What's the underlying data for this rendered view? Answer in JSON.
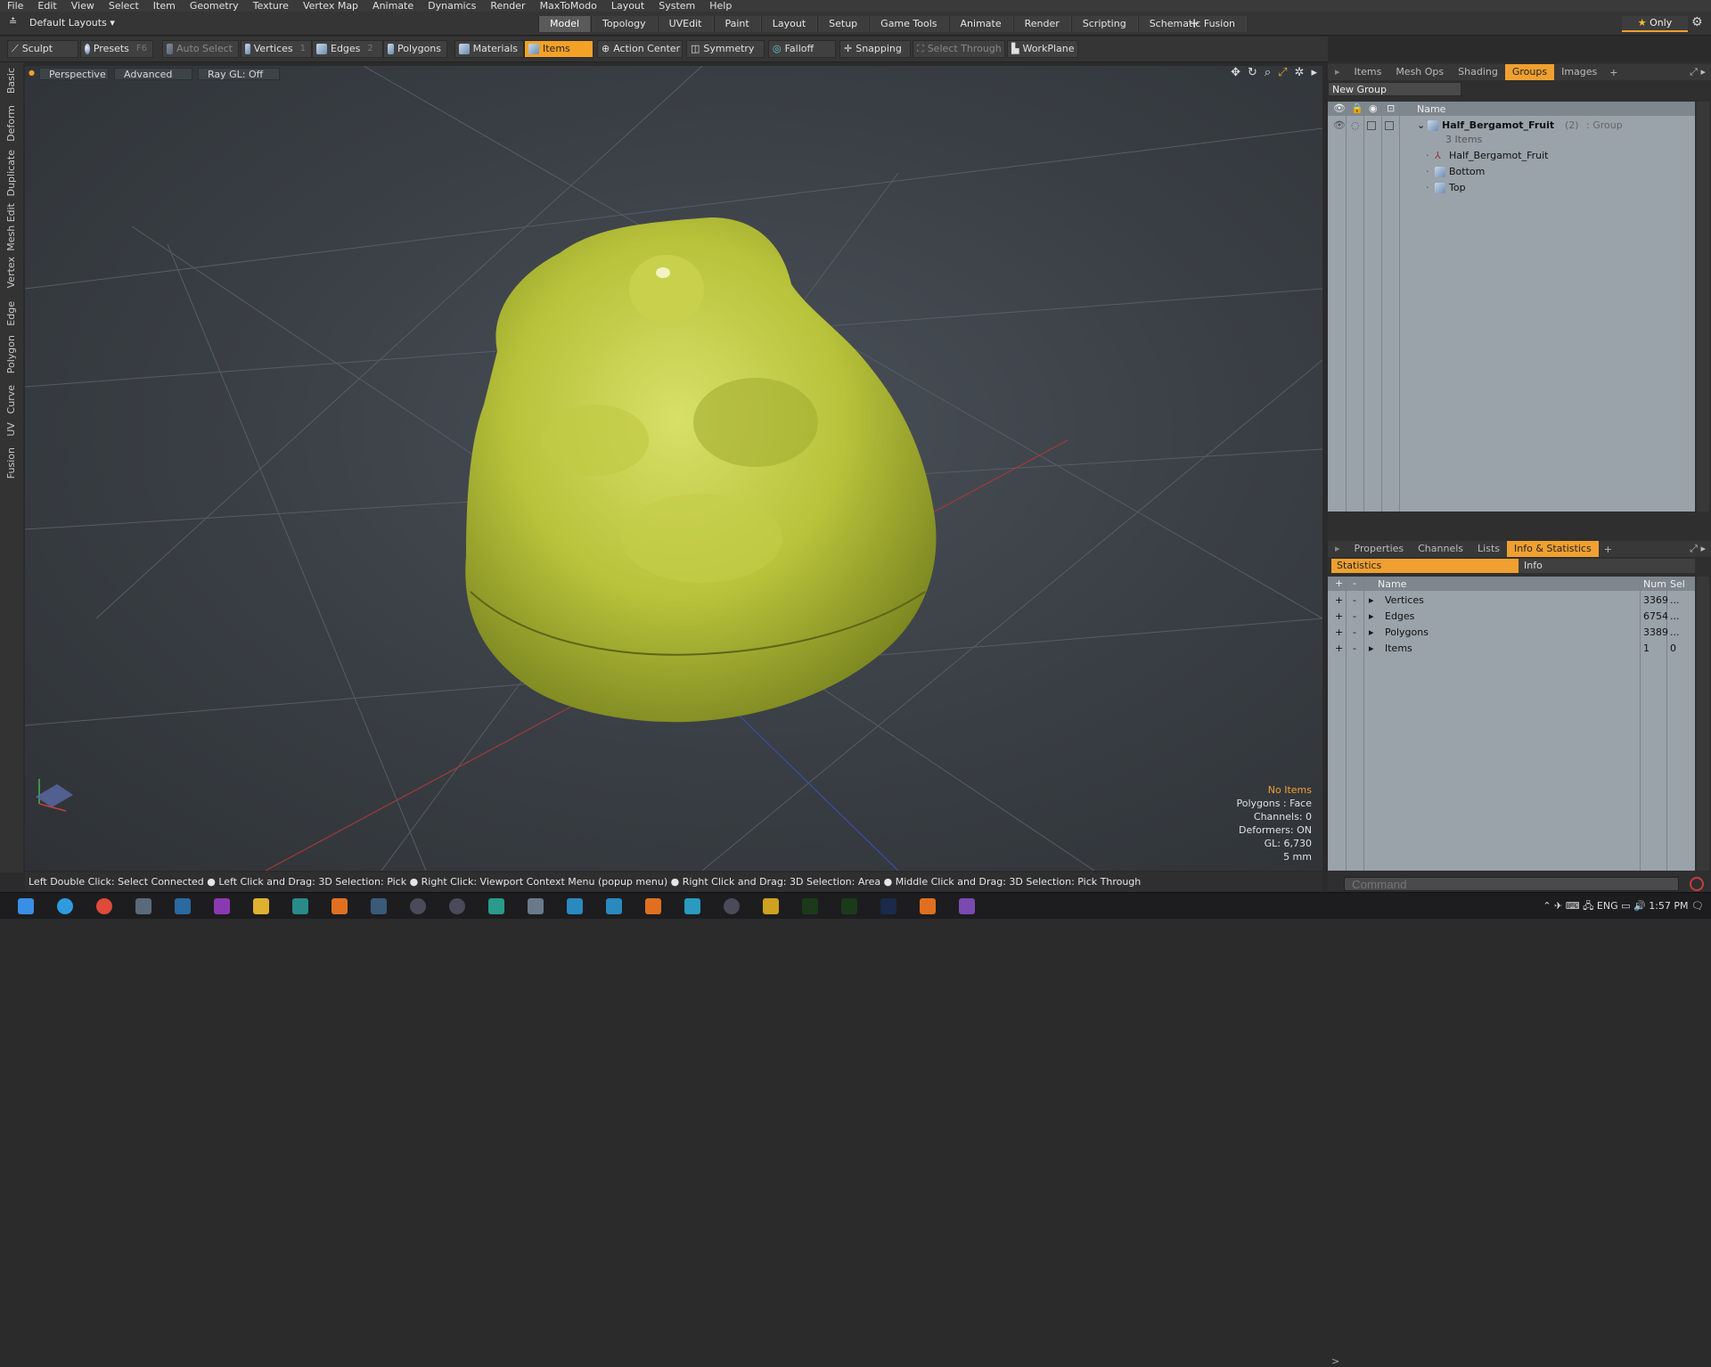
{
  "menu": [
    "File",
    "Edit",
    "View",
    "Select",
    "Item",
    "Geometry",
    "Texture",
    "Vertex Map",
    "Animate",
    "Dynamics",
    "Render",
    "MaxToModo",
    "Layout",
    "System",
    "Help"
  ],
  "layout_dropdown": "Default Layouts",
  "layout_tabs": [
    "Model",
    "Topology",
    "UVEdit",
    "Paint",
    "Layout",
    "Setup",
    "Game Tools",
    "Animate",
    "Render",
    "Scripting",
    "Schematic Fusion"
  ],
  "layout_active": "Model",
  "only_label": "Only",
  "toolbar": {
    "sculpt": "Sculpt",
    "presets": "Presets",
    "presets_key": "F6",
    "auto_select": "Auto Select",
    "vertices": "Vertices",
    "vertices_key": "1",
    "edges": "Edges",
    "edges_key": "2",
    "polygons": "Polygons",
    "materials": "Materials",
    "items": "Items",
    "action_center": "Action Center",
    "symmetry": "Symmetry",
    "falloff": "Falloff",
    "snapping": "Snapping",
    "select_through": "Select Through",
    "workplane": "WorkPlane"
  },
  "left_tabs": [
    "Basic",
    "Deform",
    "Duplicate",
    "Mesh Edit",
    "Vertex",
    "Edge",
    "Polygon",
    "Curve",
    "UV",
    "Fusion"
  ],
  "viewport": {
    "view_mode": "Perspective",
    "advanced": "Advanced",
    "raygl": "Ray GL: Off",
    "info": {
      "selection": "No Items",
      "polygons": "Polygons : Face",
      "channels": "Channels: 0",
      "deformers": "Deformers: ON",
      "gl": "GL: 6,730",
      "scale": "5 mm"
    }
  },
  "status_text": "Left Double Click: Select Connected ● Left Click and Drag: 3D Selection: Pick ● Right Click: Viewport Context Menu (popup menu) ● Right Click and Drag: 3D Selection: Area ● Middle Click and Drag: 3D Selection: Pick Through",
  "top_panel_tabs": [
    "Items",
    "Mesh Ops",
    "Shading",
    "Groups",
    "Images"
  ],
  "top_panel_active": "Groups",
  "groups": {
    "new_group": "New Group",
    "name_header": "Name",
    "group_name": "Half_Bergamot_Fruit",
    "group_count": "(2)",
    "group_type": ": Group",
    "items_count": "3 Items",
    "children": [
      "Half_Bergamot_Fruit",
      "Bottom",
      "Top"
    ]
  },
  "bottom_panel_tabs": [
    "Properties",
    "Channels",
    "Lists",
    "Info & Statistics"
  ],
  "bottom_panel_active": "Info & Statistics",
  "stats": {
    "subtab_statistics": "Statistics",
    "subtab_info": "Info",
    "headers": {
      "name": "Name",
      "num": "Num",
      "sel": "Sel"
    },
    "rows": [
      {
        "name": "Vertices",
        "num": "3369",
        "sel": "..."
      },
      {
        "name": "Edges",
        "num": "6754",
        "sel": "..."
      },
      {
        "name": "Polygons",
        "num": "3389",
        "sel": "..."
      },
      {
        "name": "Items",
        "num": "1",
        "sel": "0"
      }
    ]
  },
  "command_placeholder": "Command",
  "taskbar": {
    "lang": "ENG",
    "time": "1:57 PM"
  },
  "colors": {
    "accent": "#f0a030",
    "fruit": "#b8c23a"
  }
}
